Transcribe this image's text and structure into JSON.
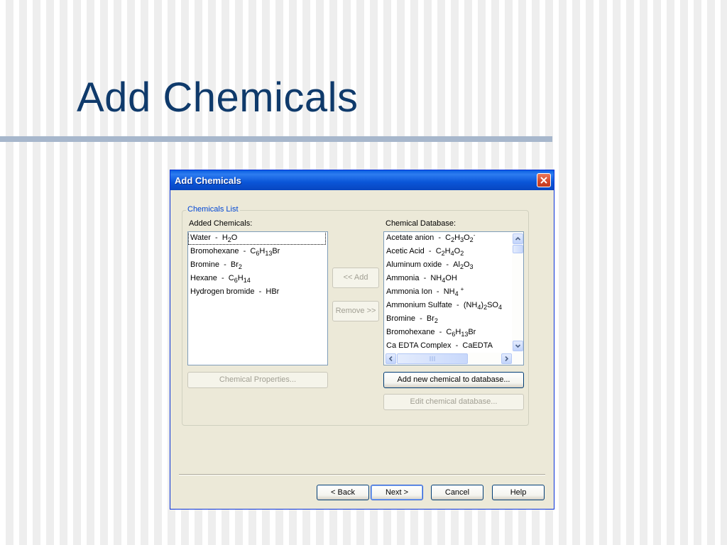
{
  "slide": {
    "title": "Add Chemicals"
  },
  "dialog": {
    "title": "Add Chemicals",
    "group_label": "Chemicals List",
    "added_label": "Added Chemicals:",
    "database_label": "Chemical Database:",
    "added_chemicals": [
      {
        "name": "Water",
        "formula": "H2O"
      },
      {
        "name": "Bromohexane",
        "formula": "C6H13Br"
      },
      {
        "name": "Bromine",
        "formula": "Br2"
      },
      {
        "name": "Hexane",
        "formula": "C6H14"
      },
      {
        "name": "Hydrogen bromide",
        "formula": "HBr"
      }
    ],
    "database_chemicals": [
      {
        "name": "Acetate anion",
        "formula": "C2H3O2-"
      },
      {
        "name": "Acetic Acid",
        "formula": "C2H4O2"
      },
      {
        "name": "Aluminum oxide",
        "formula": "Al2O3"
      },
      {
        "name": "Ammonia",
        "formula": "NH4OH"
      },
      {
        "name": "Ammonia Ion",
        "formula": "NH4 +"
      },
      {
        "name": "Ammonium Sulfate",
        "formula": "(NH4)2SO4"
      },
      {
        "name": "Bromine",
        "formula": "Br2"
      },
      {
        "name": "Bromohexane",
        "formula": "C6H13Br"
      },
      {
        "name": "Ca EDTA Complex",
        "formula": "CaEDTA"
      }
    ],
    "buttons": {
      "add": "<< Add",
      "remove": "Remove >>",
      "chemical_properties": "Chemical Properties...",
      "add_new": "Add new chemical to database...",
      "edit_db": "Edit chemical database...",
      "back": "< Back",
      "next": "Next >",
      "cancel": "Cancel",
      "help": "Help"
    }
  },
  "colors": {
    "title_text": "#0f3a6b",
    "titlebar": "#0a55d8",
    "dialog_bg": "#ece9d8",
    "group_label": "#0046d5"
  }
}
